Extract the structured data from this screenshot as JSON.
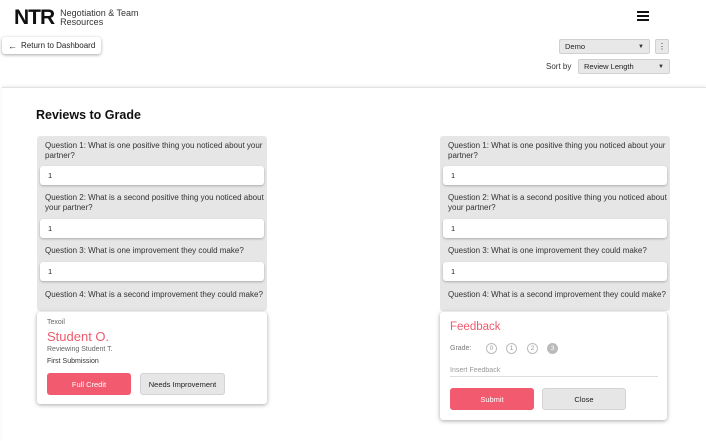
{
  "header": {
    "logo_mark": "NTR",
    "logo_text": "Negotiation & Team Resources",
    "return_label": "Return to Dashboard",
    "demo_select": "Demo",
    "sort_label": "Sort by",
    "sort_select": "Review Length"
  },
  "page": {
    "title": "Reviews to Grade"
  },
  "reviews": [
    {
      "questions": [
        {
          "label": "Question 1: What is one positive thing you noticed about your partner?",
          "answer": "1"
        },
        {
          "label": "Question 2: What is a second positive thing you noticed about your partner?",
          "answer": "1"
        },
        {
          "label": "Question 3: What is one improvement they could make?",
          "answer": "1"
        },
        {
          "label": "Question 4: What is a second improvement they could make?",
          "answer": ""
        }
      ],
      "student": {
        "team": "Texoil",
        "name": "Student O.",
        "reviewing": "Reviewing Student T.",
        "submission": "First Submission",
        "full_credit_label": "Full Credit",
        "needs_improvement_label": "Needs Improvement"
      }
    },
    {
      "questions": [
        {
          "label": "Question 1: What is one positive thing you noticed about your partner?",
          "answer": "1"
        },
        {
          "label": "Question 2: What is a second positive thing you noticed about your partner?",
          "answer": "1"
        },
        {
          "label": "Question 3: What is one improvement they could make?",
          "answer": "1"
        },
        {
          "label": "Question 4: What is a second improvement they could make?",
          "answer": ""
        }
      ],
      "feedback": {
        "title": "Feedback",
        "grade_label": "Grade:",
        "grade_options": [
          "0",
          "1",
          "2",
          "3"
        ],
        "selected_grade": "3",
        "input_placeholder": "Insert Feedback",
        "submit_label": "Submit",
        "close_label": "Close"
      }
    }
  ],
  "colors": {
    "accent": "#f25b6f",
    "panel_gray": "#e6e6e6"
  },
  "icons": {
    "menu": "hamburger-menu-icon",
    "back": "arrow-left-icon",
    "more": "kebab-menu-icon",
    "dropdown": "chevron-down-icon"
  }
}
